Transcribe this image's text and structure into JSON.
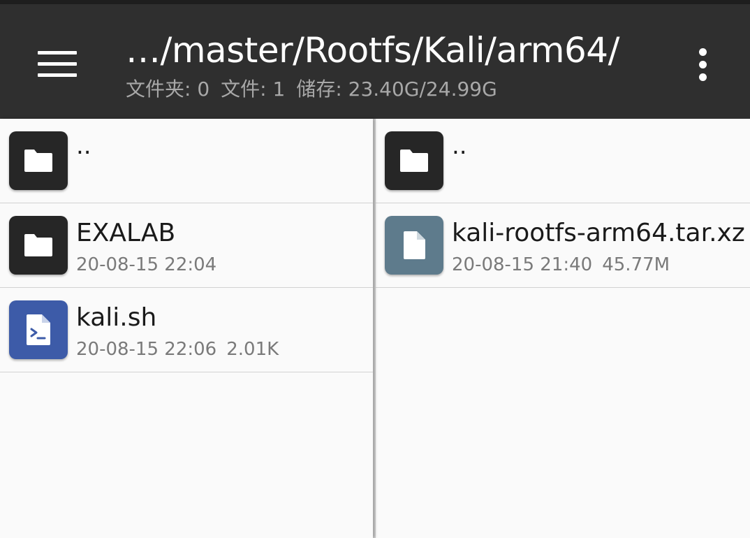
{
  "header": {
    "path": "…/master/Rootfs/Kali/arm64/",
    "folders_stat": "文件夹: 0",
    "files_stat": "文件: 1",
    "storage_stat": "储存: 23.40G/24.99G"
  },
  "left_pane": {
    "items": [
      {
        "name": "..",
        "icon": "folder-icon",
        "date": "",
        "size": ""
      },
      {
        "name": "EXALAB",
        "icon": "folder-icon",
        "date": "20-08-15 22:04",
        "size": ""
      },
      {
        "name": "kali.sh",
        "icon": "script-file-icon",
        "date": "20-08-15 22:06",
        "size": "2.01K"
      }
    ]
  },
  "right_pane": {
    "items": [
      {
        "name": "..",
        "icon": "folder-icon",
        "date": "",
        "size": ""
      },
      {
        "name": "kali-rootfs-arm64.tar.xz",
        "icon": "file-icon",
        "date": "20-08-15 21:40",
        "size": "45.77M"
      }
    ]
  },
  "colors": {
    "toolbar": "#2f2f2f",
    "folder_icon_bg": "#262626",
    "script_icon_bg": "#3d5ba8",
    "file_icon_bg": "#5e7b8c"
  }
}
